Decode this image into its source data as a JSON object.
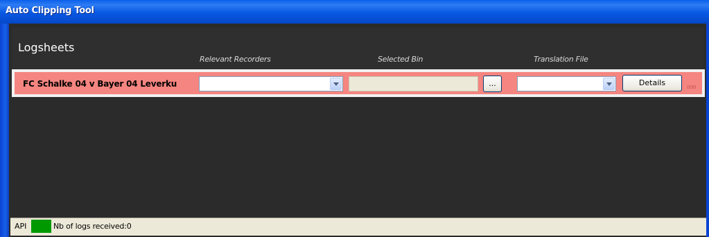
{
  "window": {
    "title": "Auto Clipping Tool"
  },
  "section": {
    "title": "Logsheets"
  },
  "columns": {
    "recorders": "Relevant Recorders",
    "bin": "Selected Bin",
    "translation": "Translation File"
  },
  "row": {
    "match": "FC Schalke 04 v Bayer 04 Leverku",
    "recorders_value": "",
    "bin_value": "",
    "browse_label": "...",
    "translation_value": "",
    "details_label": "Details",
    "tiny_label": "000"
  },
  "status": {
    "api_label": "API",
    "logs_text": "Nb of logs received:0"
  },
  "colors": {
    "row_highlight": "#f58580",
    "api_status_ok": "#009900",
    "panel_bg": "#2b2b2b"
  }
}
